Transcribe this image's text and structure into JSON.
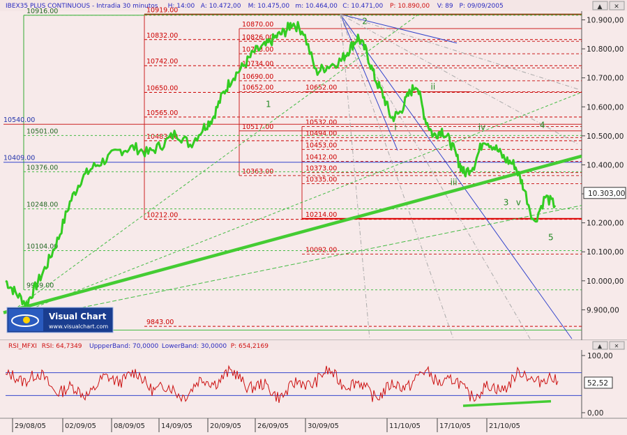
{
  "window": {
    "header_segments": [
      {
        "text": "IBEX35 PLUS CONTINUOUS - Intradia 30 minutos",
        "color": "#2a2ac0"
      },
      {
        "text": "H: 14:00",
        "color": "#2a2ac0"
      },
      {
        "text": "A: 10.472,00",
        "color": "#2a2ac0"
      },
      {
        "text": "M: 10.475,00",
        "color": "#2a2ac0"
      },
      {
        "text": "m: 10.464,00",
        "color": "#2a2ac0"
      },
      {
        "text": "C: 10.471,00",
        "color": "#2a2ac0"
      },
      {
        "text": "P: 10.890,00",
        "color": "#d01010"
      },
      {
        "text": "V: 89",
        "color": "#2a2ac0"
      },
      {
        "text": "P: 09/09/2005",
        "color": "#2a2ac0"
      }
    ],
    "controls": {
      "up": "▲",
      "close": "✕"
    }
  },
  "logo": {
    "name": "Visual Chart",
    "url": "www.visualchart.com"
  },
  "rsi_header": [
    {
      "text": "RSI_MFXI",
      "color": "#d01010"
    },
    {
      "text": "RSI: 64,7349",
      "color": "#d01010"
    },
    {
      "text": "UppperBand: 70,0000",
      "color": "#2a2ac0"
    },
    {
      "text": "LowerBand: 30,0000",
      "color": "#2a2ac0"
    },
    {
      "text": "P: 654,2169",
      "color": "#d01010"
    }
  ],
  "chart_data": [
    {
      "type": "line",
      "title": "IBEX35 PLUS CONTINUOUS - Intradia 30 minutos",
      "ylim": [
        9800,
        10930
      ],
      "y_ticks": [
        {
          "value": 10900,
          "label": "10.900,00"
        },
        {
          "value": 10800,
          "label": "10.800,00"
        },
        {
          "value": 10700,
          "label": "10.700,00"
        },
        {
          "value": 10600,
          "label": "10.600,00"
        },
        {
          "value": 10500,
          "label": "10.500,00"
        },
        {
          "value": 10400,
          "label": "10.400,00"
        },
        {
          "value": 10300,
          "label": "10.300,00"
        },
        {
          "value": 10200,
          "label": "10.200,00"
        },
        {
          "value": 10100,
          "label": "10.100,00"
        },
        {
          "value": 10000,
          "label": "10.000,00"
        },
        {
          "value": 9900,
          "label": "9.900,00"
        }
      ],
      "x_tick_labels": [
        "29/08/05",
        "02/09/05",
        "08/09/05",
        "14/09/05",
        "20/09/05",
        "26/09/05",
        "30/09/05",
        "11/10/05",
        "17/10/05",
        "21/10/05"
      ],
      "last_value": {
        "value": 10303,
        "label": "10.303,00"
      },
      "price_path": [
        [
          0,
          10000
        ],
        [
          0.7,
          9960
        ],
        [
          1.5,
          9920
        ],
        [
          2.2,
          9985
        ],
        [
          3.0,
          10060
        ],
        [
          3.8,
          10150
        ],
        [
          4.6,
          10270
        ],
        [
          5.4,
          10350
        ],
        [
          6.2,
          10390
        ],
        [
          7.2,
          10420
        ],
        [
          8.2,
          10450
        ],
        [
          9.2,
          10460
        ],
        [
          10.2,
          10440
        ],
        [
          11.2,
          10470
        ],
        [
          12.2,
          10510
        ],
        [
          13.2,
          10470
        ],
        [
          14.2,
          10530
        ],
        [
          14.8,
          10560
        ],
        [
          15.5,
          10640
        ],
        [
          16.2,
          10700
        ],
        [
          17.0,
          10740
        ],
        [
          17.8,
          10790
        ],
        [
          18.6,
          10810
        ],
        [
          19.3,
          10840
        ],
        [
          20.0,
          10860
        ],
        [
          20.5,
          10890
        ],
        [
          21.3,
          10860
        ],
        [
          22.2,
          10720
        ],
        [
          23.0,
          10740
        ],
        [
          24.0,
          10760
        ],
        [
          24.6,
          10800
        ],
        [
          25.2,
          10840
        ],
        [
          25.8,
          10790
        ],
        [
          26.4,
          10700
        ],
        [
          27.0,
          10640
        ],
        [
          27.6,
          10560
        ],
        [
          28.2,
          10580
        ],
        [
          28.8,
          10640
        ],
        [
          29.4,
          10680
        ],
        [
          30.0,
          10560
        ],
        [
          30.6,
          10500
        ],
        [
          31.2,
          10520
        ],
        [
          31.8,
          10480
        ],
        [
          32.4,
          10410
        ],
        [
          32.8,
          10370
        ],
        [
          33.5,
          10400
        ],
        [
          34.2,
          10490
        ],
        [
          35.0,
          10460
        ],
        [
          35.7,
          10420
        ],
        [
          36.4,
          10400
        ],
        [
          37.0,
          10330
        ],
        [
          37.8,
          10200
        ],
        [
          38.6,
          10290
        ],
        [
          39.3,
          10260
        ]
      ],
      "series": [
        {
          "name": "IBEX35 PLUS CONTINUOUS",
          "color": "#33cc22"
        }
      ],
      "fib_levels_left": [
        {
          "value": 10919,
          "label": "10919.00",
          "color": "#8b4513"
        },
        {
          "value": 10832,
          "label": "10832.00",
          "color": "#cc0000"
        },
        {
          "value": 10742,
          "label": "10742.00",
          "color": "#cc0000"
        },
        {
          "value": 10650,
          "label": "10650.00",
          "color": "#cc0000"
        },
        {
          "value": 10565,
          "label": "10565.00",
          "color": "#cc0000"
        },
        {
          "value": 10483,
          "label": "10483.00",
          "color": "#cc0000"
        },
        {
          "value": 10212,
          "label": "10212.00",
          "color": "#cc0000"
        },
        {
          "value": 9843,
          "label": "9843.00",
          "color": "#cc0000"
        }
      ],
      "fib_levels_mid": [
        {
          "value": 10870,
          "label": "10870.00"
        },
        {
          "value": 10826,
          "label": "10826.00"
        },
        {
          "value": 10783,
          "label": "10783.00"
        },
        {
          "value": 10734,
          "label": "10734.00"
        },
        {
          "value": 10690,
          "label": "10690.00"
        },
        {
          "value": 10652,
          "label": "10652.00"
        },
        {
          "value": 10517,
          "label": "10517.00"
        },
        {
          "value": 10363,
          "label": "10363.00"
        }
      ],
      "fib_levels_right": [
        {
          "value": 10652,
          "label": "10652.00"
        },
        {
          "value": 10532,
          "label": "10532.00"
        },
        {
          "value": 10494,
          "label": "10494.00"
        },
        {
          "value": 10453,
          "label": "10453.00"
        },
        {
          "value": 10412,
          "label": "10412.00"
        },
        {
          "value": 10373,
          "label": "10373.00"
        },
        {
          "value": 10335,
          "label": "10335.00"
        },
        {
          "value": 10214,
          "label": "10214.00"
        },
        {
          "value": 10092,
          "label": "10092.00"
        }
      ],
      "green_levels": [
        {
          "value": 10916,
          "label": "10916.00"
        },
        {
          "value": 10501,
          "label": "10501.00"
        },
        {
          "value": 10376,
          "label": "10376.00"
        },
        {
          "value": 10248,
          "label": "10248.00"
        },
        {
          "value": 10104,
          "label": "10104.00"
        },
        {
          "value": 9969,
          "label": "9969.00"
        }
      ],
      "blue_levels": [
        {
          "value": 10540,
          "label": "10540.00"
        },
        {
          "value": 10409,
          "label": "10409.00"
        }
      ],
      "wave_labels": [
        {
          "text": "1",
          "x": 18.6,
          "y": 10600
        },
        {
          "text": "2",
          "x": 25.5,
          "y": 10885
        },
        {
          "text": "i",
          "x": 27.8,
          "y": 10520
        },
        {
          "text": "ii",
          "x": 30.4,
          "y": 10660
        },
        {
          "text": "iii",
          "x": 31.8,
          "y": 10330
        },
        {
          "text": "iv",
          "x": 33.8,
          "y": 10520
        },
        {
          "text": "3",
          "x": 35.6,
          "y": 10260
        },
        {
          "text": "v",
          "x": 36.5,
          "y": 10260
        },
        {
          "text": "4",
          "x": 38.2,
          "y": 10527
        },
        {
          "text": "5",
          "x": 38.8,
          "y": 10140
        }
      ]
    },
    {
      "type": "line",
      "title": "RSI_MFXI",
      "ylim": [
        0,
        100
      ],
      "y_ticks": [
        {
          "value": 100,
          "label": "100,00"
        },
        {
          "value": 0,
          "label": "0,00"
        }
      ],
      "last_value": {
        "value": 52.52,
        "label": "52,52"
      },
      "bands": {
        "upper": 70,
        "lower": 30
      },
      "series": [
        {
          "name": "RSI",
          "color": "#cc1111"
        }
      ]
    }
  ]
}
